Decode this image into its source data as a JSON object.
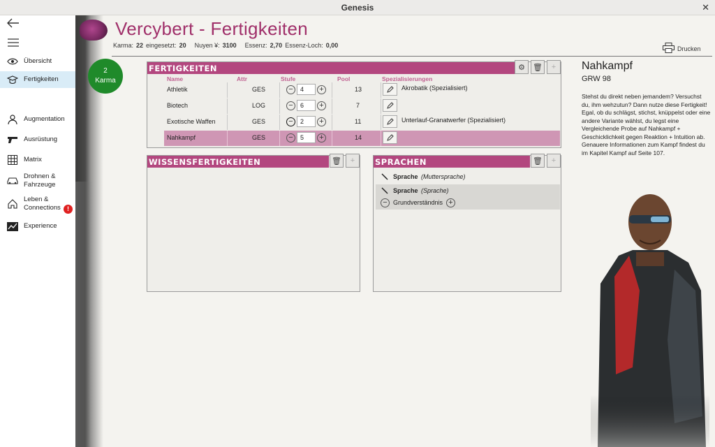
{
  "window": {
    "title": "Genesis"
  },
  "sidebar": {
    "items": [
      {
        "label": "Übersicht",
        "icon": "eye-icon"
      },
      {
        "label": "Fertigkeiten",
        "icon": "graduation-cap-icon"
      },
      {
        "label": "Augmentation",
        "icon": "person-icon"
      },
      {
        "label": "Ausrüstung",
        "icon": "gun-icon"
      },
      {
        "label": "Matrix",
        "icon": "grid-icon"
      },
      {
        "label_line1": "Drohnen &",
        "label_line2": "Fahrzeuge",
        "icon": "car-icon"
      },
      {
        "label_line1": "Leben &",
        "label_line2": "Connections",
        "icon": "home-icon",
        "badge": "!"
      },
      {
        "label": "Experience",
        "icon": "chart-icon"
      }
    ]
  },
  "header": {
    "title": "Vercybert - Fertigkeiten",
    "stats": {
      "karma_label": "Karma:",
      "karma_value": "22",
      "used_label": "eingesetzt:",
      "used_value": "20",
      "nuyen_label": "Nuyen ¥:",
      "nuyen_value": "3100",
      "essence_label": "Essenz:",
      "essence_value": "2,70",
      "hole_label": "Essenz-Loch:",
      "hole_value": "0,00"
    },
    "print_label": "Drucken"
  },
  "karma_badge": {
    "value": "2",
    "label": "Karma"
  },
  "skills": {
    "title": "Fertigkeiten",
    "columns": {
      "name": "Name",
      "attr": "Attr",
      "stufe": "Stufe",
      "pool": "Pool",
      "spec": "Spezialisierungen"
    },
    "rows": [
      {
        "name": "Athletik",
        "attr": "GES",
        "stufe": "4",
        "pool": "13",
        "spec": "Akrobatik (Spezialisiert)"
      },
      {
        "name": "Biotech",
        "attr": "LOG",
        "stufe": "6",
        "pool": "7",
        "spec": ""
      },
      {
        "name": "Exotische Waffen",
        "attr": "GES",
        "stufe": "2",
        "pool": "11",
        "spec": "Unterlauf-Granatwerfer (Spezialisiert)"
      },
      {
        "name": "Nahkampf",
        "attr": "GES",
        "stufe": "5",
        "pool": "14",
        "spec": ""
      }
    ]
  },
  "knowledge": {
    "title": "Wissensfertigkeiten"
  },
  "languages": {
    "title": "Sprachen",
    "rows": [
      {
        "name": "Sprache",
        "type": "(Muttersprache)"
      },
      {
        "name": "Sprache",
        "type": "(Sprache)",
        "level": "Grundverständnis"
      }
    ]
  },
  "detail": {
    "title": "Nahkampf",
    "subtitle": "GRW 98",
    "text": "Stehst du direkt neben jemandem? Versuchst du, ihm wehzutun? Dann nutze diese Fertigkeit! Egal, ob du schlägst, stichst, knüppelst oder eine andere Variante wählst, du legst eine Vergleichende Probe auf Nahkampf + Geschicklichkeit gegen Reaktion + Intuition ab.\nGenauere Informationen zum Kampf findest du im Kapitel Kampf auf Seite 107."
  },
  "colors": {
    "accent": "#b3477f",
    "title": "#a0306a",
    "karma": "#1f8a2a",
    "selected_row": "#cf96b4",
    "nav_active": "#d9ecf7"
  }
}
